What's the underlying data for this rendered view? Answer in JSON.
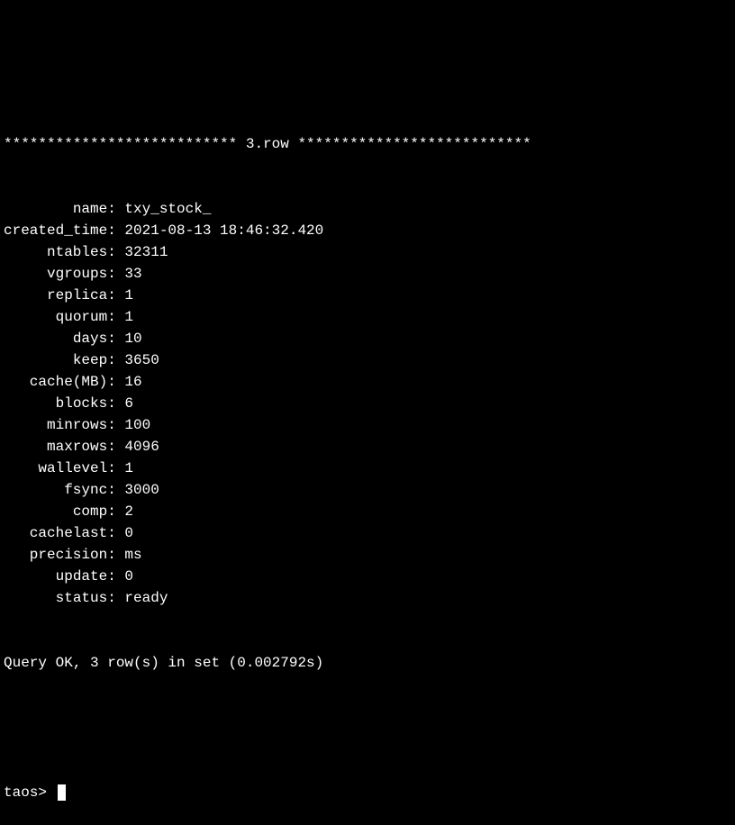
{
  "row_header": "*************************** 3.row ***************************",
  "fields": [
    {
      "key": "name",
      "value": "txy_stock_"
    },
    {
      "key": "created_time",
      "value": "2021-08-13 18:46:32.420"
    },
    {
      "key": "ntables",
      "value": "32311"
    },
    {
      "key": "vgroups",
      "value": "33"
    },
    {
      "key": "replica",
      "value": "1"
    },
    {
      "key": "quorum",
      "value": "1"
    },
    {
      "key": "days",
      "value": "10"
    },
    {
      "key": "keep",
      "value": "3650"
    },
    {
      "key": "cache(MB)",
      "value": "16"
    },
    {
      "key": "blocks",
      "value": "6"
    },
    {
      "key": "minrows",
      "value": "100"
    },
    {
      "key": "maxrows",
      "value": "4096"
    },
    {
      "key": "wallevel",
      "value": "1"
    },
    {
      "key": "fsync",
      "value": "3000"
    },
    {
      "key": "comp",
      "value": "2"
    },
    {
      "key": "cachelast",
      "value": "0"
    },
    {
      "key": "precision",
      "value": "ms"
    },
    {
      "key": "update",
      "value": "0"
    },
    {
      "key": "status",
      "value": "ready"
    }
  ],
  "summary": "Query OK, 3 row(s) in set (0.002792s)",
  "prompt": "taos> "
}
